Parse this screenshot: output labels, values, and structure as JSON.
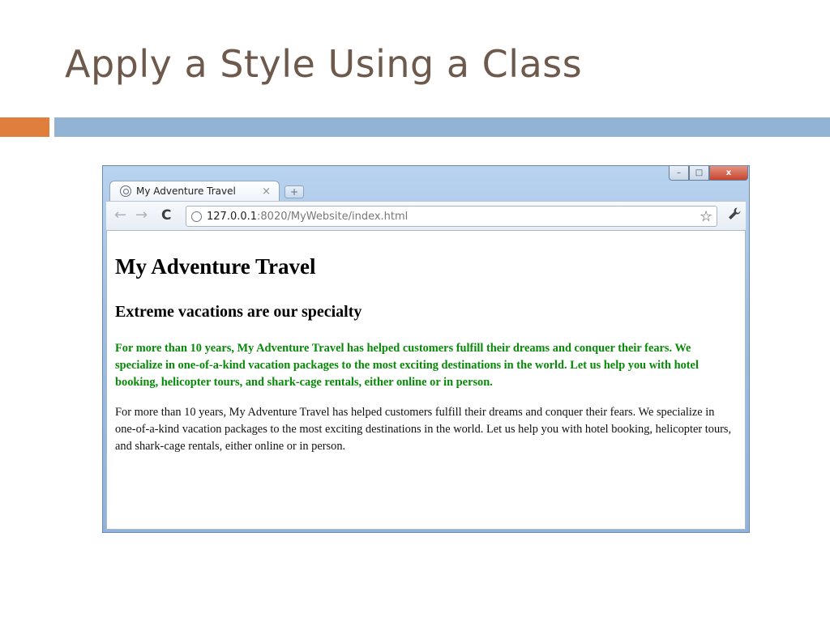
{
  "slide": {
    "title": "Apply a Style Using a Class"
  },
  "window_controls": {
    "minimize": "–",
    "maximize": "□",
    "close": "x"
  },
  "tab": {
    "title": "My Adventure Travel",
    "close": "×",
    "icon": "globe-icon"
  },
  "toolbar": {
    "back": "←",
    "forward": "→",
    "reload": "C",
    "url_host": "127.0.0.1",
    "url_rest": ":8020/MyWebsite/index.html",
    "star": "☆",
    "wrench": "🔧"
  },
  "page": {
    "heading": "My Adventure Travel",
    "subheading": "Extreme vacations are our specialty",
    "paragraph_styled": "For more than 10 years, My Adventure Travel has helped customers fulfill their dreams and conquer their fears. We specialize in one-of-a-kind vacation packages to the most exciting destinations in the world. Let us help you with hotel booking, helicopter tours, and shark-cage rentals, either online or in person.",
    "paragraph_plain": "For more than 10 years, My Adventure Travel has helped customers fulfill their dreams and conquer their fears. We specialize in one-of-a-kind vacation packages to the most exciting destinations in the world. Let us help you with hotel booking, helicopter tours, and shark-cage rentals, either online or in person."
  },
  "colors": {
    "title": "#6d5a4d",
    "accent_orange": "#e07e3c",
    "accent_blue": "#92b3d3",
    "styled_text": "#078a07"
  }
}
